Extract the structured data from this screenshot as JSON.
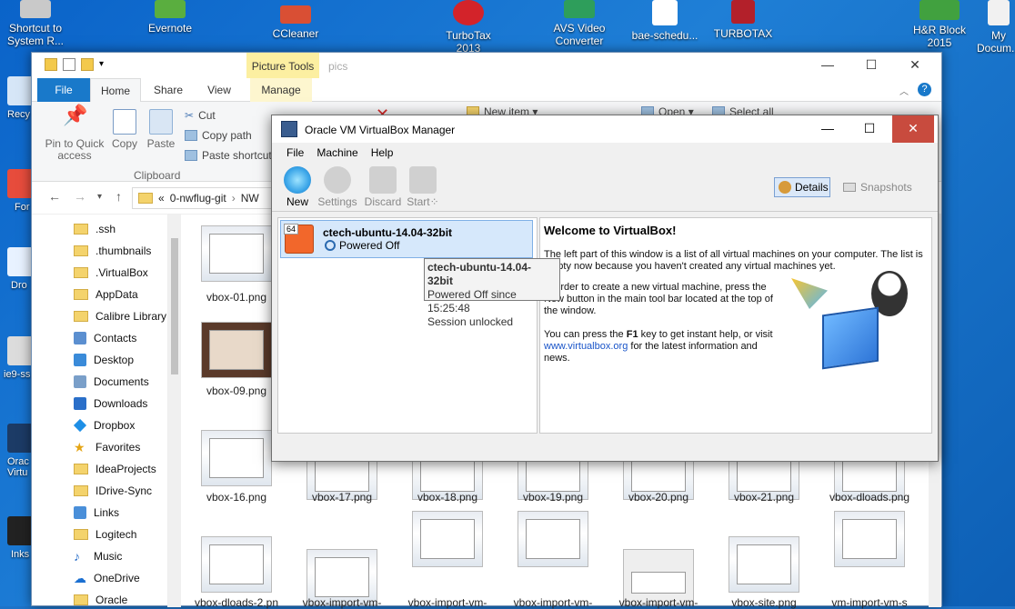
{
  "desktop": {
    "icons_top": [
      {
        "label": "Shortcut to\nSystem R...",
        "color": "#c0c0c0"
      },
      {
        "label": "Evernote",
        "color": "#5aae3f"
      },
      {
        "label": "CCleaner",
        "color": "#d94f34"
      },
      {
        "label": "TurboTax\n2013",
        "color": "#d3232a"
      },
      {
        "label": "AVS Video\nConverter",
        "color": "#2e9e5b"
      },
      {
        "label": "bae-schedu...",
        "color": "#ffffff"
      },
      {
        "label": "TURBOTAX",
        "color": "#b3202a"
      },
      {
        "label": "H&R Block\n2015",
        "color": "#41a13f"
      },
      {
        "label": "My\nDocum...",
        "color": "#f1f1f1"
      }
    ],
    "icons_side": [
      {
        "label": "Recy",
        "color": "#d6e6f7"
      },
      {
        "label": "For",
        "color": "#e74c3c"
      },
      {
        "label": "Dro",
        "color": "#e8f2ff"
      },
      {
        "label": "ie9-ss",
        "color": "#dcdcdc"
      },
      {
        "label": "Orac\nVirtu",
        "color": "#1c3b66"
      },
      {
        "label": "Inks",
        "color": "#222222"
      }
    ]
  },
  "explorer": {
    "context_tab": "Picture Tools",
    "window_title": "pics",
    "window_buttons": {
      "min": "—",
      "max": "☐",
      "close": "✕"
    },
    "tabs": [
      "File",
      "Home",
      "Share",
      "View",
      "Manage"
    ],
    "ribbon": {
      "pin": "Pin to Quick\naccess",
      "copy": "Copy",
      "paste": "Paste",
      "cut": "Cut",
      "copy_path": "Copy path",
      "paste_shortcut": "Paste shortcut",
      "clipboard_group": "Clipboard",
      "new_item": "New item ▾",
      "open": "Open ▾",
      "select_all": "Select all"
    },
    "address": {
      "prefix": "«",
      "crumb1": "0-nwflug-git",
      "crumb2": "NW"
    },
    "sidebar": [
      {
        "label": ".ssh",
        "icon": "folder"
      },
      {
        "label": ".thumbnails",
        "icon": "folder"
      },
      {
        "label": ".VirtualBox",
        "icon": "folder"
      },
      {
        "label": "AppData",
        "icon": "folder"
      },
      {
        "label": "Calibre Library",
        "icon": "folder"
      },
      {
        "label": "Contacts",
        "icon": "contacts"
      },
      {
        "label": "Desktop",
        "icon": "desktop"
      },
      {
        "label": "Documents",
        "icon": "documents"
      },
      {
        "label": "Downloads",
        "icon": "downloads"
      },
      {
        "label": "Dropbox",
        "icon": "dropbox"
      },
      {
        "label": "Favorites",
        "icon": "star"
      },
      {
        "label": "IdeaProjects",
        "icon": "folder"
      },
      {
        "label": "IDrive-Sync",
        "icon": "folder"
      },
      {
        "label": "Links",
        "icon": "links"
      },
      {
        "label": "Logitech",
        "icon": "folder"
      },
      {
        "label": "Music",
        "icon": "music"
      },
      {
        "label": "OneDrive",
        "icon": "onedrive"
      },
      {
        "label": "Oracle",
        "icon": "folder"
      }
    ],
    "files_row1": [
      "vbox-01.png"
    ],
    "files_row2": [
      "vbox-09.png"
    ],
    "files_row3": [
      "vbox-16.png",
      "vbox-17.png",
      "vbox-18.png",
      "vbox-19.png",
      "vbox-20.png",
      "vbox-21.png",
      "vbox-dloads.png"
    ],
    "files_row4": [
      "vbox-dloads-2.pn",
      "vbox-import-vm-",
      "vbox-import-vm-",
      "vbox-import-vm-",
      "vbox-import-vm-",
      "vbox-site.png",
      "vm-import-vm-s"
    ]
  },
  "virtualbox": {
    "title": "Oracle VM VirtualBox Manager",
    "menu": [
      "File",
      "Machine",
      "Help"
    ],
    "toolbar": {
      "new": "New",
      "settings": "Settings",
      "discard": "Discard",
      "start": "Start⁘"
    },
    "details": "Details",
    "snapshots": "Snapshots",
    "vm": {
      "badge": "64",
      "name": "ctech-ubuntu-14.04-32bit",
      "state": "Powered Off"
    },
    "tooltip": {
      "name": "ctech-ubuntu-14.04-32bit",
      "line1": "Powered Off since 15:25:48",
      "line2": "Session unlocked"
    },
    "welcome": {
      "title": "Welcome to VirtualBox!",
      "p1": "The left part of this window is a list of all virtual machines on your computer. The list is empty now because you haven't created any virtual machines yet.",
      "p2a": "In order to create a new virtual machine, press the",
      "p2b": "New button in the main tool bar located at the top of",
      "p2c": "the window.",
      "p3a": "You can press the ",
      "p3key": "F1",
      "p3b": " key to get instant help, or visit",
      "link": "www.virtualbox.org",
      "p3c": " for the latest information and",
      "p3d": "news."
    }
  }
}
